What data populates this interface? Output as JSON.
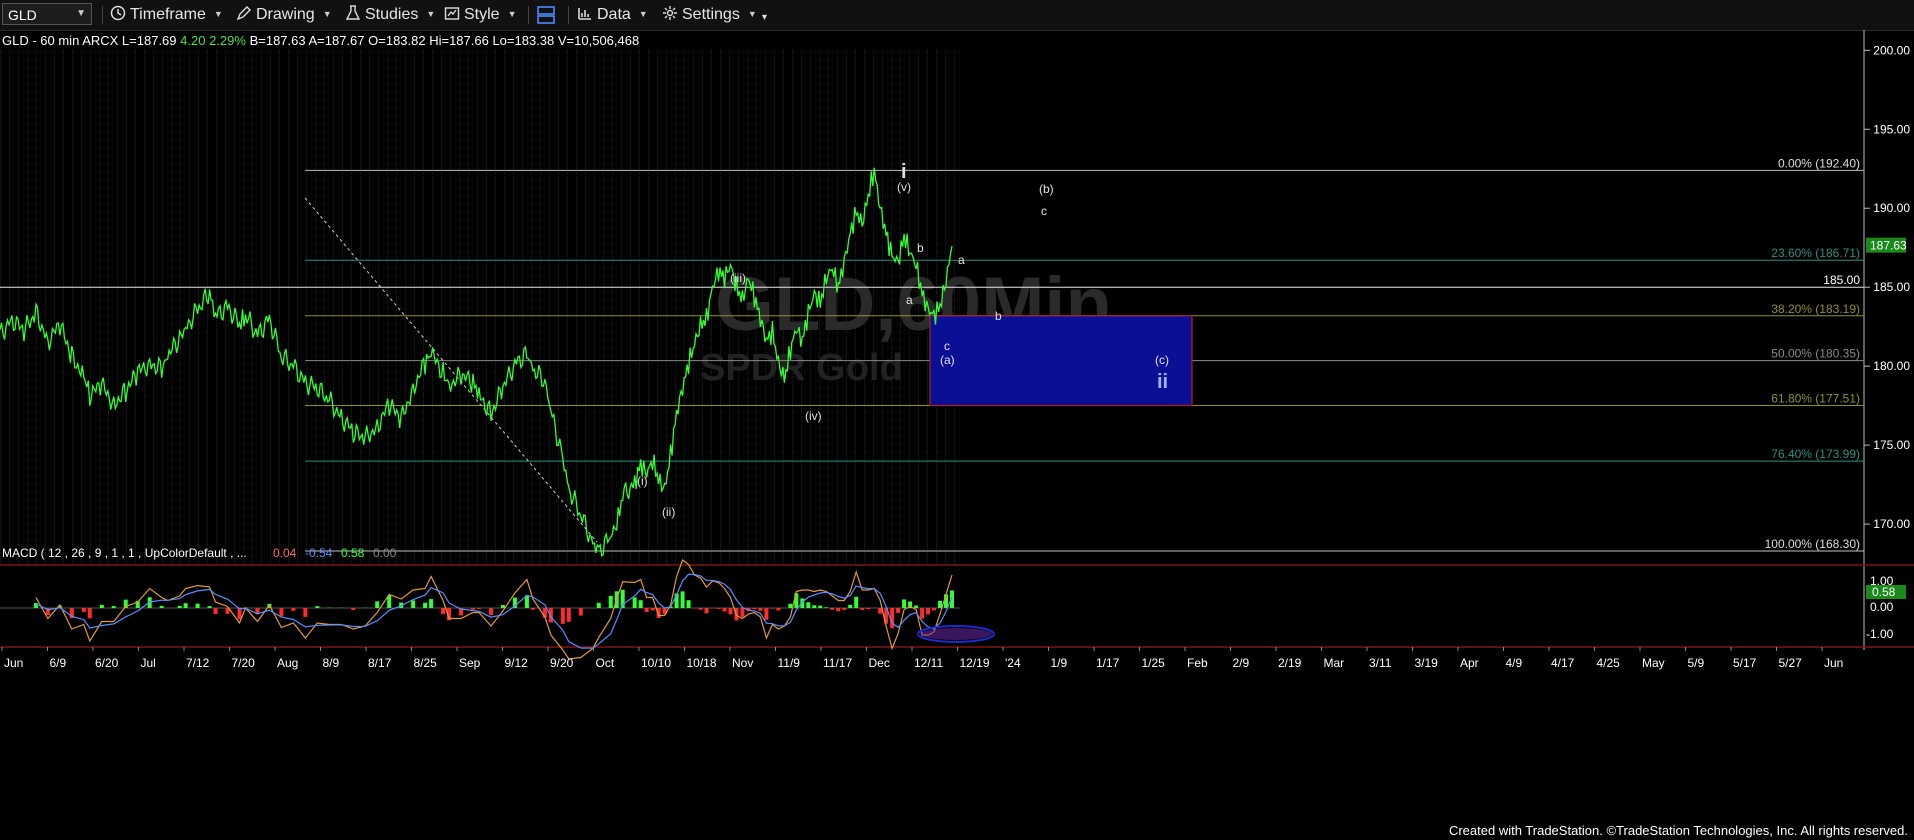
{
  "toolbar": {
    "symbol": "GLD",
    "items": [
      {
        "label": "Timeframe",
        "icon": "clock-icon"
      },
      {
        "label": "Drawing",
        "icon": "pencil-icon"
      },
      {
        "label": "Studies",
        "icon": "flask-icon"
      },
      {
        "label": "Style",
        "icon": "style-icon"
      },
      {
        "label": "",
        "icon": "layout-icon"
      },
      {
        "label": "Data",
        "icon": "bar-chart-icon"
      },
      {
        "label": "Settings",
        "icon": "gear-icon"
      }
    ]
  },
  "info": {
    "prefix": "GLD - 60 min  ARCX  L=187.69",
    "change": "4.20",
    "change_pct": "2.29%",
    "suffix": "B=187.63  A=187.67  O=183.82  Hi=187.66  Lo=183.38  V=10,506,468"
  },
  "watermark": {
    "line1": "GLD,60Min",
    "line2": "SPDR Gold"
  },
  "colors": {
    "price": "#33ff33",
    "accent_blue": "#0a0f96",
    "background": "#000000"
  },
  "chart_data": {
    "type": "line",
    "title": "GLD - 60 min",
    "price_axis": {
      "min": 168,
      "max": 200,
      "ticks": [
        "200.00",
        "195.00",
        "190.00",
        "185.00",
        "180.00",
        "175.00",
        "170.00"
      ]
    },
    "last_price_tag": "187.63",
    "horizontal_level": "185.00",
    "fib_levels": [
      {
        "label": "0.00% (192.40)",
        "value": 192.4,
        "color": "#bfbfbf"
      },
      {
        "label": "23.60% (186.71)",
        "value": 186.71,
        "color": "#2f8f7f"
      },
      {
        "label": "38.20% (183.19)",
        "value": 183.19,
        "color": "#8f8f2f"
      },
      {
        "label": "50.00% (180.35)",
        "value": 180.35,
        "color": "#8a8a8a"
      },
      {
        "label": "61.80% (177.51)",
        "value": 177.51,
        "color": "#8f8f2f"
      },
      {
        "label": "76.40% (173.99)",
        "value": 173.99,
        "color": "#2f8f7f"
      },
      {
        "label": "100.00% (168.30)",
        "value": 168.3,
        "color": "#bfbfbf"
      }
    ],
    "target_box": {
      "from": 183.19,
      "to": 177.51
    },
    "x_labels": [
      "Jun",
      "6/9",
      "6/20",
      "Jul",
      "7/12",
      "7/20",
      "Aug",
      "8/9",
      "8/17",
      "8/25",
      "Sep",
      "9/12",
      "9/20",
      "Oct",
      "10/10",
      "10/18",
      "Nov",
      "11/9",
      "11/17",
      "Dec",
      "12/11",
      "12/19",
      "'24",
      "1/9",
      "1/17",
      "1/25",
      "Feb",
      "2/9",
      "2/19",
      "Mar",
      "3/11",
      "3/19",
      "Apr",
      "4/9",
      "4/17",
      "4/25",
      "May",
      "5/9",
      "5/17",
      "5/27",
      "Jun"
    ],
    "wave_labels": [
      "i",
      "(v)",
      "b",
      "a",
      "a",
      "c",
      "(a)",
      "b",
      "(iii)",
      "(iv)",
      "(i)",
      "(ii)",
      "(b)",
      "c",
      "(c)",
      "ii"
    ],
    "price_series": [
      [
        0,
        182.0
      ],
      [
        2,
        183.0
      ],
      [
        4,
        182.2
      ],
      [
        6,
        183.4
      ],
      [
        8,
        181.6
      ],
      [
        10,
        182.6
      ],
      [
        12,
        180.6
      ],
      [
        14,
        179.4
      ],
      [
        15,
        178.2
      ],
      [
        17,
        178.8
      ],
      [
        19,
        177.6
      ],
      [
        21,
        178.4
      ],
      [
        23,
        179.6
      ],
      [
        25,
        180.2
      ],
      [
        27,
        179.8
      ],
      [
        28,
        180.6
      ],
      [
        30,
        181.8
      ],
      [
        31,
        182.4
      ],
      [
        33,
        183.6
      ],
      [
        35,
        184.6
      ],
      [
        36,
        183.2
      ],
      [
        38,
        183.8
      ],
      [
        40,
        182.6
      ],
      [
        41,
        183.2
      ],
      [
        43,
        182.0
      ],
      [
        45,
        183.0
      ],
      [
        47,
        180.6
      ],
      [
        49,
        180.0
      ],
      [
        51,
        179.0
      ],
      [
        53,
        178.6
      ],
      [
        55,
        177.8
      ],
      [
        57,
        176.8
      ],
      [
        59,
        175.8
      ],
      [
        61,
        175.4
      ],
      [
        63,
        176.2
      ],
      [
        65,
        177.6
      ],
      [
        67,
        176.6
      ],
      [
        69,
        178.6
      ],
      [
        71,
        180.2
      ],
      [
        72,
        180.8
      ],
      [
        74,
        179.6
      ],
      [
        75,
        178.8
      ],
      [
        77,
        179.4
      ],
      [
        79,
        179.0
      ],
      [
        80,
        178.2
      ],
      [
        82,
        177.0
      ],
      [
        84,
        178.6
      ],
      [
        86,
        180.2
      ],
      [
        88,
        180.8
      ],
      [
        89,
        179.8
      ],
      [
        91,
        179.0
      ],
      [
        92,
        177.2
      ],
      [
        94,
        174.2
      ],
      [
        95,
        172.2
      ],
      [
        97,
        170.6
      ],
      [
        99,
        168.8
      ],
      [
        100,
        168.3
      ],
      [
        102,
        169.2
      ],
      [
        103,
        170.0
      ],
      [
        104,
        171.8
      ],
      [
        106,
        172.6
      ],
      [
        107,
        173.8
      ],
      [
        108,
        173.2
      ],
      [
        109,
        174.0
      ],
      [
        110,
        172.8
      ],
      [
        111,
        172.2
      ],
      [
        112,
        174.4
      ],
      [
        113,
        177.0
      ],
      [
        114,
        178.6
      ],
      [
        115,
        180.2
      ],
      [
        116,
        181.4
      ],
      [
        117,
        182.6
      ],
      [
        118,
        183.0
      ],
      [
        119,
        185.0
      ],
      [
        120,
        186.0
      ],
      [
        121,
        185.6
      ],
      [
        122,
        186.4
      ],
      [
        123,
        185.0
      ],
      [
        124,
        184.2
      ],
      [
        125,
        185.6
      ],
      [
        126,
        184.4
      ],
      [
        127,
        183.0
      ],
      [
        128,
        181.6
      ],
      [
        129,
        182.2
      ],
      [
        130,
        180.2
      ],
      [
        131,
        179.2
      ],
      [
        132,
        181.0
      ],
      [
        133,
        182.4
      ],
      [
        134,
        181.6
      ],
      [
        135,
        183.4
      ],
      [
        136,
        184.6
      ],
      [
        137,
        184.0
      ],
      [
        138,
        185.6
      ],
      [
        139,
        186.2
      ],
      [
        140,
        185.0
      ],
      [
        141,
        186.6
      ],
      [
        142,
        188.4
      ],
      [
        143,
        189.8
      ],
      [
        144,
        189.0
      ],
      [
        145,
        190.8
      ],
      [
        146,
        192.4
      ],
      [
        147,
        190.0
      ],
      [
        148,
        188.4
      ],
      [
        149,
        187.0
      ],
      [
        150,
        186.6
      ],
      [
        151,
        188.2
      ],
      [
        152,
        187.2
      ],
      [
        153,
        186.4
      ],
      [
        154,
        184.6
      ],
      [
        155,
        183.6
      ],
      [
        156,
        183.2
      ],
      [
        157,
        183.8
      ],
      [
        158,
        185.4
      ],
      [
        159,
        187.6
      ]
    ],
    "macd": {
      "label": "MACD ( 12 , 26 , 9 , 1 , 1 , UpColorDefault , ...",
      "values": [
        "0.04",
        "-0.54",
        "0.58",
        "0.00"
      ],
      "value_colors": [
        "#ff6b6b",
        "#5b8dff",
        "#33ff33",
        "#888888"
      ],
      "axis_ticks": [
        "1.00",
        "0.00",
        "-1.00"
      ],
      "last_tag": "0.58"
    }
  },
  "footer": "Created with TradeStation. ©TradeStation Technologies, Inc. All rights reserved."
}
